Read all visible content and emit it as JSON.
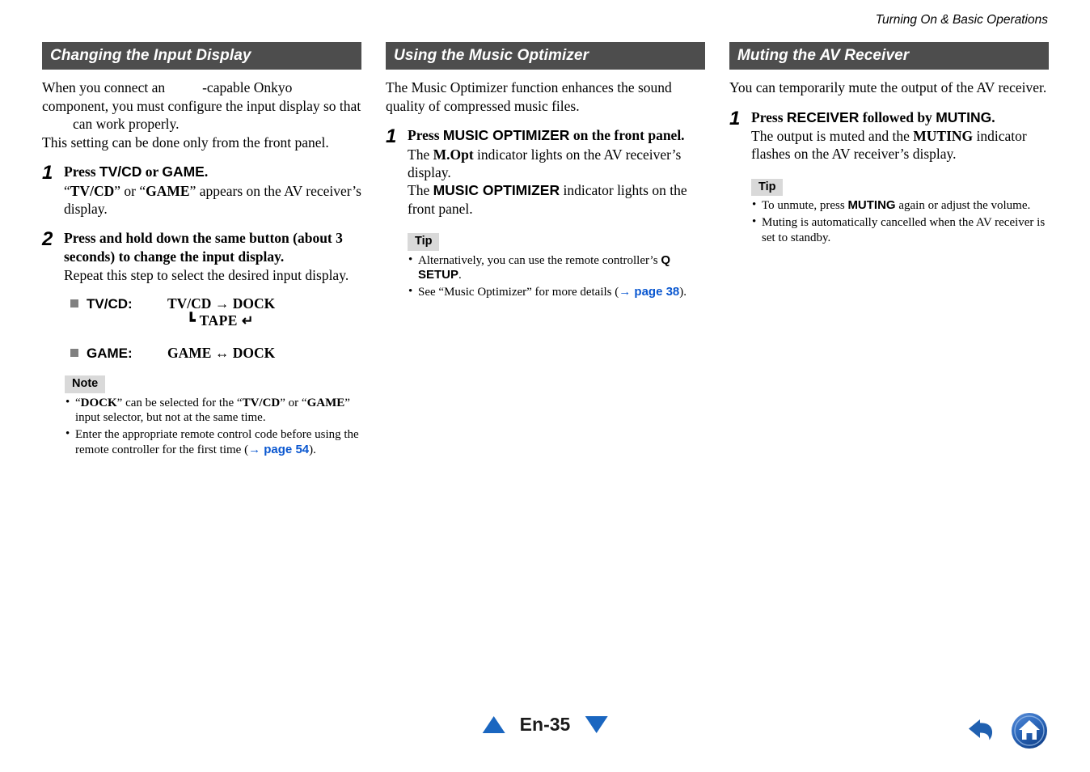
{
  "running_head": "Turning On & Basic Operations",
  "colors": {
    "section_bar": "#4d4d4d",
    "callout_label_bg": "#d9d9d9",
    "link": "#0a57d0",
    "accent_blue": "#1a66c0",
    "bullet_square": "#808080"
  },
  "columns": [
    {
      "heading": "Changing the Input Display",
      "intro": {
        "line1_before": "When you connect an",
        "line1_after": "-capable Onkyo component, you must configure the input display so that",
        "line1_end": "can work properly.",
        "line2": "This setting can be done only from the front panel."
      },
      "steps": [
        {
          "num": "1",
          "title_parts": [
            {
              "text": "Press ",
              "style": "serif-bold"
            },
            {
              "text": "TV/CD",
              "style": "sans-bold"
            },
            {
              "text": " or ",
              "style": "serif-bold"
            },
            {
              "text": "GAME",
              "style": "sans-bold"
            },
            {
              "text": ".",
              "style": "serif-bold"
            }
          ],
          "desc_parts": [
            {
              "text": "“",
              "style": "regular"
            },
            {
              "text": "TV/CD",
              "style": "serif-bold"
            },
            {
              "text": "” or “",
              "style": "regular"
            },
            {
              "text": "GAME",
              "style": "serif-bold"
            },
            {
              "text": "” appears on the AV receiver’s display.",
              "style": "regular"
            }
          ]
        },
        {
          "num": "2",
          "title_parts": [
            {
              "text": "Press and hold down the same button (about 3 seconds) to change the input display.",
              "style": "serif-bold"
            }
          ],
          "desc_parts": [
            {
              "text": "Repeat this step to select the desired input display.",
              "style": "regular"
            }
          ]
        }
      ],
      "diagram": [
        {
          "label": "TV/CD:",
          "line1": "TV/CD  →  DOCK",
          "line2": "┗ TAPE  ↵",
          "line2_prefix": "↑"
        },
        {
          "label": "GAME:",
          "line1": "GAME ↔ DOCK",
          "line2": "",
          "line2_prefix": ""
        }
      ],
      "callout": {
        "label": "Note",
        "items": [
          {
            "parts": [
              {
                "text": "“",
                "style": "regular"
              },
              {
                "text": "DOCK",
                "style": "serif-bold"
              },
              {
                "text": "” can be selected for the “",
                "style": "regular"
              },
              {
                "text": "TV/CD",
                "style": "serif-bold"
              },
              {
                "text": "” or “",
                "style": "regular"
              },
              {
                "text": "GAME",
                "style": "serif-bold"
              },
              {
                "text": "” input selector, but not at the same time.",
                "style": "regular"
              }
            ]
          },
          {
            "parts": [
              {
                "text": "Enter the appropriate remote control code before using the remote controller for the first time (",
                "style": "regular"
              },
              {
                "text": "→ page 54",
                "style": "link"
              },
              {
                "text": ").",
                "style": "regular"
              }
            ]
          }
        ]
      }
    },
    {
      "heading": "Using the Music Optimizer",
      "intro": {
        "line1": "The Music Optimizer function enhances the sound quality of compressed music files."
      },
      "steps": [
        {
          "num": "1",
          "title_parts": [
            {
              "text": "Press ",
              "style": "serif-bold"
            },
            {
              "text": "MUSIC OPTIMIZER",
              "style": "sans-bold"
            },
            {
              "text": " on the front panel.",
              "style": "serif-bold"
            }
          ],
          "desc_parts": [
            {
              "text": "The ",
              "style": "regular"
            },
            {
              "text": "M.Opt",
              "style": "serif-bold"
            },
            {
              "text": " indicator lights on the AV receiver’s display.",
              "style": "regular"
            },
            {
              "text": "\n",
              "style": "break"
            },
            {
              "text": "The ",
              "style": "regular"
            },
            {
              "text": "MUSIC OPTIMIZER",
              "style": "sans-bold"
            },
            {
              "text": " indicator lights on the front panel.",
              "style": "regular"
            }
          ]
        }
      ],
      "callout": {
        "label": "Tip",
        "items": [
          {
            "parts": [
              {
                "text": "Alternatively, you can use the remote controller’s ",
                "style": "regular"
              },
              {
                "text": "Q SETUP",
                "style": "sans-bold"
              },
              {
                "text": ".",
                "style": "regular"
              }
            ]
          },
          {
            "parts": [
              {
                "text": "See “Music Optimizer” for more details (",
                "style": "regular"
              },
              {
                "text": "→ page 38",
                "style": "link"
              },
              {
                "text": ").",
                "style": "regular"
              }
            ]
          }
        ]
      }
    },
    {
      "heading": "Muting the AV Receiver",
      "intro": {
        "line1": "You can temporarily mute the output of the AV receiver."
      },
      "steps": [
        {
          "num": "1",
          "title_parts": [
            {
              "text": "Press ",
              "style": "serif-bold"
            },
            {
              "text": "RECEIVER",
              "style": "sans-bold"
            },
            {
              "text": " followed by ",
              "style": "serif-bold"
            },
            {
              "text": "MUTING",
              "style": "sans-bold"
            },
            {
              "text": ".",
              "style": "serif-bold"
            }
          ],
          "desc_parts": [
            {
              "text": "The output is muted and the ",
              "style": "regular"
            },
            {
              "text": "MUTING",
              "style": "serif-bold"
            },
            {
              "text": " indicator flashes on the AV receiver’s display.",
              "style": "regular"
            }
          ]
        }
      ],
      "callout": {
        "label": "Tip",
        "items": [
          {
            "parts": [
              {
                "text": "To unmute, press ",
                "style": "regular"
              },
              {
                "text": "MUTING",
                "style": "sans-bold"
              },
              {
                "text": " again or adjust the volume.",
                "style": "regular"
              }
            ]
          },
          {
            "parts": [
              {
                "text": "Muting is automatically cancelled when the AV receiver is set to standby.",
                "style": "regular"
              }
            ]
          }
        ]
      }
    }
  ],
  "footer": {
    "prev_icon": "triangle-up-icon",
    "page_label": "En-35",
    "next_icon": "triangle-down-icon",
    "back_icon": "back-arrow-icon",
    "home_icon": "home-icon"
  }
}
